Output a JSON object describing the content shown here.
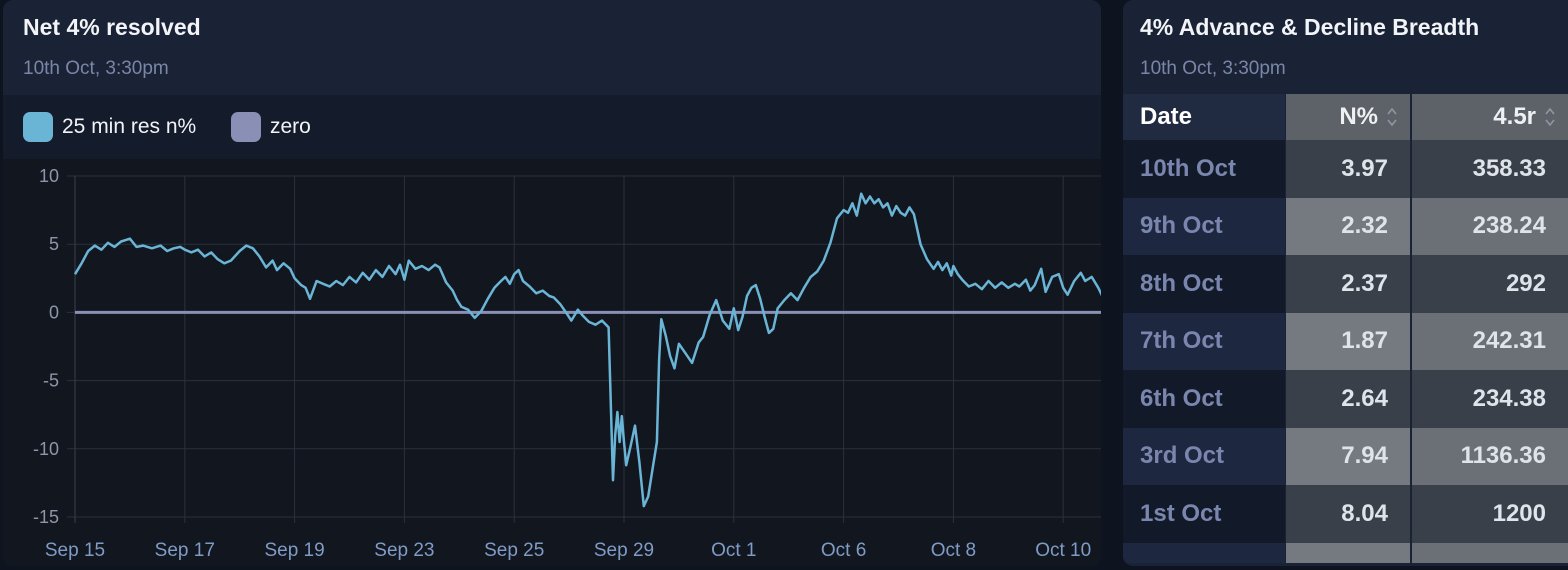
{
  "left_panel": {
    "title": "Net 4% resolved",
    "subtitle": "10th Oct, 3:30pm",
    "legend": [
      {
        "label": "25 min res n%",
        "color": "#6ab4d6"
      },
      {
        "label": "zero",
        "color": "#8a8fb6"
      }
    ]
  },
  "chart_data": {
    "type": "line",
    "x_tick_labels": [
      "Sep 15",
      "Sep 17",
      "Sep 19",
      "Sep 23",
      "Sep 25",
      "Sep 29",
      "Oct 1",
      "Oct 6",
      "Oct 8",
      "Oct 10"
    ],
    "y_ticks": [
      10,
      5,
      0,
      -5,
      -10,
      -15
    ],
    "ylim": [
      -15,
      10
    ],
    "grid": true,
    "legend_position": "top-left",
    "series": [
      {
        "name": "25 min res n%",
        "color": "#6ab4d6",
        "x_unit": "session index (0 = Sep 15, 9 = Oct 10)",
        "points": [
          [
            0.0,
            2.8
          ],
          [
            0.06,
            3.6
          ],
          [
            0.12,
            4.5
          ],
          [
            0.18,
            4.9
          ],
          [
            0.24,
            4.6
          ],
          [
            0.3,
            5.1
          ],
          [
            0.36,
            4.8
          ],
          [
            0.42,
            5.2
          ],
          [
            0.5,
            5.4
          ],
          [
            0.56,
            4.8
          ],
          [
            0.62,
            4.9
          ],
          [
            0.7,
            4.7
          ],
          [
            0.78,
            4.9
          ],
          [
            0.84,
            4.5
          ],
          [
            0.9,
            4.7
          ],
          [
            0.96,
            4.8
          ],
          [
            1.0,
            4.6
          ],
          [
            1.06,
            4.4
          ],
          [
            1.12,
            4.6
          ],
          [
            1.18,
            4.1
          ],
          [
            1.24,
            4.4
          ],
          [
            1.3,
            3.9
          ],
          [
            1.36,
            3.6
          ],
          [
            1.42,
            3.8
          ],
          [
            1.5,
            4.5
          ],
          [
            1.56,
            4.9
          ],
          [
            1.62,
            4.7
          ],
          [
            1.68,
            4.1
          ],
          [
            1.74,
            3.3
          ],
          [
            1.8,
            3.8
          ],
          [
            1.84,
            3.1
          ],
          [
            1.9,
            3.6
          ],
          [
            1.96,
            3.2
          ],
          [
            2.0,
            2.5
          ],
          [
            2.06,
            2.0
          ],
          [
            2.1,
            1.8
          ],
          [
            2.14,
            1.0
          ],
          [
            2.2,
            2.3
          ],
          [
            2.26,
            2.1
          ],
          [
            2.32,
            1.9
          ],
          [
            2.38,
            2.3
          ],
          [
            2.44,
            2.0
          ],
          [
            2.5,
            2.6
          ],
          [
            2.56,
            2.2
          ],
          [
            2.62,
            2.9
          ],
          [
            2.68,
            2.4
          ],
          [
            2.74,
            3.1
          ],
          [
            2.8,
            2.6
          ],
          [
            2.86,
            3.4
          ],
          [
            2.92,
            2.8
          ],
          [
            2.96,
            3.5
          ],
          [
            3.0,
            2.4
          ],
          [
            3.04,
            3.8
          ],
          [
            3.1,
            3.2
          ],
          [
            3.16,
            3.4
          ],
          [
            3.22,
            3.1
          ],
          [
            3.28,
            3.5
          ],
          [
            3.32,
            3.3
          ],
          [
            3.38,
            2.2
          ],
          [
            3.44,
            1.6
          ],
          [
            3.48,
            0.9
          ],
          [
            3.52,
            0.4
          ],
          [
            3.58,
            0.2
          ],
          [
            3.64,
            -0.4
          ],
          [
            3.7,
            0.1
          ],
          [
            3.76,
            1.0
          ],
          [
            3.82,
            1.8
          ],
          [
            3.88,
            2.3
          ],
          [
            3.92,
            2.6
          ],
          [
            3.96,
            2.1
          ],
          [
            4.0,
            2.8
          ],
          [
            4.04,
            3.1
          ],
          [
            4.08,
            2.3
          ],
          [
            4.14,
            1.9
          ],
          [
            4.2,
            1.4
          ],
          [
            4.26,
            1.6
          ],
          [
            4.32,
            1.2
          ],
          [
            4.36,
            1.1
          ],
          [
            4.42,
            0.6
          ],
          [
            4.48,
            -0.1
          ],
          [
            4.52,
            -0.6
          ],
          [
            4.58,
            0.2
          ],
          [
            4.62,
            -0.2
          ],
          [
            4.68,
            -0.7
          ],
          [
            4.74,
            -0.9
          ],
          [
            4.8,
            -0.6
          ],
          [
            4.86,
            -1.1
          ],
          [
            4.9,
            -12.3
          ],
          [
            4.92,
            -9.0
          ],
          [
            4.94,
            -7.3
          ],
          [
            4.96,
            -9.5
          ],
          [
            4.98,
            -7.6
          ],
          [
            5.0,
            -9.5
          ],
          [
            5.02,
            -11.2
          ],
          [
            5.06,
            -9.8
          ],
          [
            5.1,
            -8.3
          ],
          [
            5.14,
            -11.0
          ],
          [
            5.18,
            -14.2
          ],
          [
            5.22,
            -13.5
          ],
          [
            5.26,
            -11.5
          ],
          [
            5.3,
            -9.5
          ],
          [
            5.32,
            -3.5
          ],
          [
            5.34,
            -0.5
          ],
          [
            5.38,
            -1.7
          ],
          [
            5.42,
            -3.2
          ],
          [
            5.46,
            -4.1
          ],
          [
            5.5,
            -2.3
          ],
          [
            5.56,
            -3.0
          ],
          [
            5.62,
            -3.7
          ],
          [
            5.68,
            -2.2
          ],
          [
            5.72,
            -1.8
          ],
          [
            5.78,
            -0.2
          ],
          [
            5.84,
            0.9
          ],
          [
            5.9,
            -0.6
          ],
          [
            5.96,
            -1.2
          ],
          [
            6.0,
            0.3
          ],
          [
            6.04,
            -1.3
          ],
          [
            6.08,
            -0.3
          ],
          [
            6.12,
            1.2
          ],
          [
            6.16,
            1.8
          ],
          [
            6.2,
            2.0
          ],
          [
            6.24,
            1.0
          ],
          [
            6.28,
            -0.3
          ],
          [
            6.32,
            -1.5
          ],
          [
            6.36,
            -1.2
          ],
          [
            6.4,
            0.3
          ],
          [
            6.46,
            0.9
          ],
          [
            6.52,
            1.4
          ],
          [
            6.58,
            0.9
          ],
          [
            6.64,
            1.8
          ],
          [
            6.7,
            2.6
          ],
          [
            6.76,
            3.0
          ],
          [
            6.82,
            3.8
          ],
          [
            6.88,
            5.1
          ],
          [
            6.94,
            6.9
          ],
          [
            7.0,
            7.5
          ],
          [
            7.04,
            7.3
          ],
          [
            7.08,
            8.0
          ],
          [
            7.12,
            7.1
          ],
          [
            7.16,
            8.7
          ],
          [
            7.2,
            8.0
          ],
          [
            7.24,
            8.5
          ],
          [
            7.28,
            8.0
          ],
          [
            7.32,
            8.3
          ],
          [
            7.36,
            7.7
          ],
          [
            7.4,
            8.0
          ],
          [
            7.44,
            7.1
          ],
          [
            7.48,
            7.8
          ],
          [
            7.52,
            7.3
          ],
          [
            7.56,
            7.1
          ],
          [
            7.6,
            7.7
          ],
          [
            7.64,
            7.2
          ],
          [
            7.7,
            5.0
          ],
          [
            7.76,
            3.9
          ],
          [
            7.82,
            3.2
          ],
          [
            7.86,
            3.7
          ],
          [
            7.9,
            3.1
          ],
          [
            7.94,
            3.6
          ],
          [
            7.98,
            2.7
          ],
          [
            8.0,
            3.4
          ],
          [
            8.04,
            2.8
          ],
          [
            8.08,
            2.4
          ],
          [
            8.14,
            1.9
          ],
          [
            8.2,
            2.1
          ],
          [
            8.26,
            1.7
          ],
          [
            8.32,
            2.3
          ],
          [
            8.38,
            1.8
          ],
          [
            8.44,
            2.2
          ],
          [
            8.5,
            1.8
          ],
          [
            8.56,
            2.1
          ],
          [
            8.6,
            1.9
          ],
          [
            8.66,
            2.4
          ],
          [
            8.7,
            1.6
          ],
          [
            8.74,
            2.0
          ],
          [
            8.8,
            3.2
          ],
          [
            8.84,
            1.5
          ],
          [
            8.9,
            2.6
          ],
          [
            8.96,
            2.8
          ],
          [
            9.0,
            1.8
          ],
          [
            9.04,
            1.3
          ],
          [
            9.1,
            2.3
          ],
          [
            9.16,
            2.9
          ],
          [
            9.2,
            2.3
          ],
          [
            9.26,
            2.6
          ],
          [
            9.32,
            1.8
          ],
          [
            9.38,
            0.8
          ],
          [
            9.42,
            0.3
          ],
          [
            9.46,
            0.1
          ],
          [
            9.52,
            1.8
          ],
          [
            9.56,
            0.9
          ],
          [
            9.62,
            1.4
          ],
          [
            9.68,
            0.8
          ],
          [
            9.72,
            1.0
          ],
          [
            9.8,
            1.6
          ],
          [
            9.86,
            1.8
          ],
          [
            9.9,
            1.0
          ],
          [
            9.94,
            1.7
          ],
          [
            9.98,
            2.9
          ],
          [
            10.02,
            3.5
          ],
          [
            10.06,
            4.4
          ],
          [
            10.12,
            4.8
          ],
          [
            10.18,
            4.6
          ],
          [
            10.24,
            4.9
          ],
          [
            10.3,
            4.1
          ],
          [
            10.36,
            4.4
          ],
          [
            10.42,
            4.2
          ],
          [
            10.48,
            3.5
          ],
          [
            10.52,
            3.7
          ]
        ]
      },
      {
        "name": "zero",
        "color": "#8a8fb6",
        "points": [
          [
            0.0,
            0
          ],
          [
            10.52,
            0
          ]
        ]
      }
    ]
  },
  "right_panel": {
    "title": "4% Advance & Decline Breadth",
    "subtitle": "10th Oct, 3:30pm",
    "table": {
      "headers": {
        "date": "Date",
        "n_pct": "N%",
        "ratio": "4.5r"
      },
      "rows": [
        {
          "date": "10th Oct",
          "n_pct": "3.97",
          "ratio": "358.33"
        },
        {
          "date": "9th Oct",
          "n_pct": "2.32",
          "ratio": "238.24"
        },
        {
          "date": "8th Oct",
          "n_pct": "2.37",
          "ratio": "292"
        },
        {
          "date": "7th Oct",
          "n_pct": "1.87",
          "ratio": "242.31"
        },
        {
          "date": "6th Oct",
          "n_pct": "2.64",
          "ratio": "234.38"
        },
        {
          "date": "3rd Oct",
          "n_pct": "7.94",
          "ratio": "1136.36"
        },
        {
          "date": "1st Oct",
          "n_pct": "8.04",
          "ratio": "1200"
        }
      ]
    }
  }
}
